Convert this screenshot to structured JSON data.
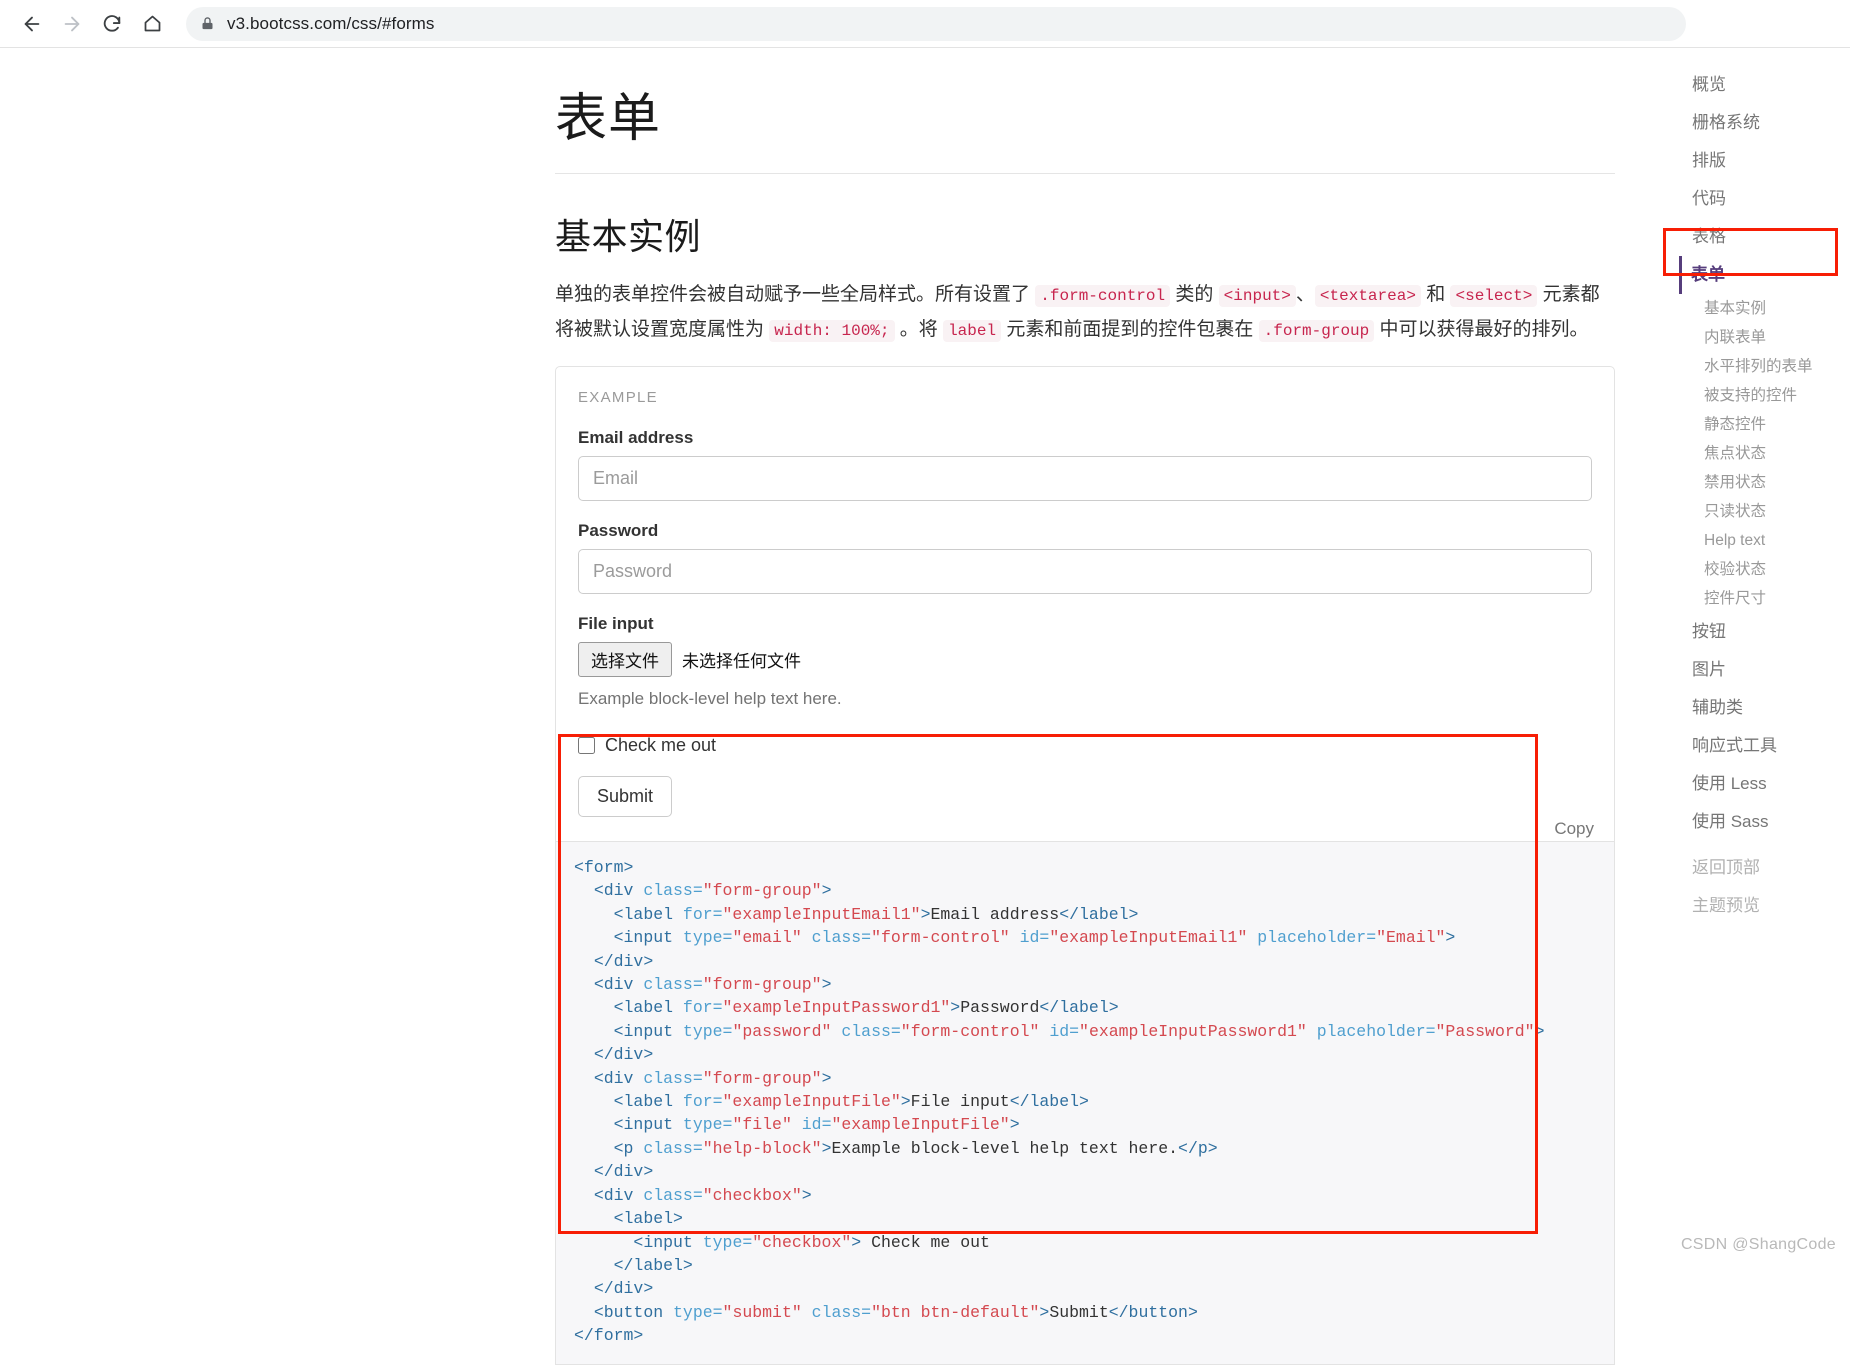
{
  "browser": {
    "back_icon": "arrow-left-icon",
    "forward_icon": "arrow-right-icon",
    "reload_icon": "reload-icon",
    "home_icon": "home-icon",
    "lock_icon": "lock-icon",
    "url": "v3.bootcss.com/css/#forms"
  },
  "main": {
    "page_title": "表单",
    "section_title": "基本实例",
    "paragraph": {
      "p1": "单独的表单控件会被自动赋予一些全局样式。所有设置了 ",
      "c1": ".form-control",
      "p2": " 类的 ",
      "c2": "<input>",
      "p3": "、",
      "c3": "<textarea>",
      "p4": " 和 ",
      "c4": "<select>",
      "p5": " 元素都将被默认设置宽度属性为 ",
      "c5": "width: 100%;",
      "p6": " 。将 ",
      "c6": "label",
      "p7": " 元素和前面提到的控件包裹在 ",
      "c7": ".form-group",
      "p8": " 中可以获得最好的排列。"
    }
  },
  "example": {
    "label": "EXAMPLE",
    "email_label": "Email address",
    "email_placeholder": "Email",
    "email_value": "",
    "password_label": "Password",
    "password_placeholder": "Password",
    "password_value": "",
    "file_label": "File input",
    "file_button": "选择文件",
    "file_status": "未选择任何文件",
    "help_text": "Example block-level help text here.",
    "checkbox_label": "Check me out",
    "checkbox_checked": false,
    "submit_label": "Submit"
  },
  "code": {
    "copy_label": "Copy",
    "lines": [
      [
        [
          "t-tag",
          "<form>"
        ]
      ],
      [
        [
          "t-txt",
          "  "
        ],
        [
          "t-tag",
          "<div "
        ],
        [
          "t-attr",
          "class="
        ],
        [
          "t-str",
          "\"form-group\""
        ],
        [
          "t-tag",
          ">"
        ]
      ],
      [
        [
          "t-txt",
          "    "
        ],
        [
          "t-tag",
          "<label "
        ],
        [
          "t-attr",
          "for="
        ],
        [
          "t-str",
          "\"exampleInputEmail1\""
        ],
        [
          "t-tag",
          ">"
        ],
        [
          "t-txt",
          "Email address"
        ],
        [
          "t-tag",
          "</label>"
        ]
      ],
      [
        [
          "t-txt",
          "    "
        ],
        [
          "t-tag",
          "<input "
        ],
        [
          "t-attr",
          "type="
        ],
        [
          "t-str",
          "\"email\""
        ],
        [
          "t-txt",
          " "
        ],
        [
          "t-attr",
          "class="
        ],
        [
          "t-str",
          "\"form-control\""
        ],
        [
          "t-txt",
          " "
        ],
        [
          "t-attr",
          "id="
        ],
        [
          "t-str",
          "\"exampleInputEmail1\""
        ],
        [
          "t-txt",
          " "
        ],
        [
          "t-attr",
          "placeholder="
        ],
        [
          "t-str",
          "\"Email\""
        ],
        [
          "t-tag",
          ">"
        ]
      ],
      [
        [
          "t-txt",
          "  "
        ],
        [
          "t-tag",
          "</div>"
        ]
      ],
      [
        [
          "t-txt",
          "  "
        ],
        [
          "t-tag",
          "<div "
        ],
        [
          "t-attr",
          "class="
        ],
        [
          "t-str",
          "\"form-group\""
        ],
        [
          "t-tag",
          ">"
        ]
      ],
      [
        [
          "t-txt",
          "    "
        ],
        [
          "t-tag",
          "<label "
        ],
        [
          "t-attr",
          "for="
        ],
        [
          "t-str",
          "\"exampleInputPassword1\""
        ],
        [
          "t-tag",
          ">"
        ],
        [
          "t-txt",
          "Password"
        ],
        [
          "t-tag",
          "</label>"
        ]
      ],
      [
        [
          "t-txt",
          "    "
        ],
        [
          "t-tag",
          "<input "
        ],
        [
          "t-attr",
          "type="
        ],
        [
          "t-str",
          "\"password\""
        ],
        [
          "t-txt",
          " "
        ],
        [
          "t-attr",
          "class="
        ],
        [
          "t-str",
          "\"form-control\""
        ],
        [
          "t-txt",
          " "
        ],
        [
          "t-attr",
          "id="
        ],
        [
          "t-str",
          "\"exampleInputPassword1\""
        ],
        [
          "t-txt",
          " "
        ],
        [
          "t-attr",
          "placeholder="
        ],
        [
          "t-str",
          "\"Password\""
        ],
        [
          "t-tag",
          ">"
        ]
      ],
      [
        [
          "t-txt",
          "  "
        ],
        [
          "t-tag",
          "</div>"
        ]
      ],
      [
        [
          "t-txt",
          "  "
        ],
        [
          "t-tag",
          "<div "
        ],
        [
          "t-attr",
          "class="
        ],
        [
          "t-str",
          "\"form-group\""
        ],
        [
          "t-tag",
          ">"
        ]
      ],
      [
        [
          "t-txt",
          "    "
        ],
        [
          "t-tag",
          "<label "
        ],
        [
          "t-attr",
          "for="
        ],
        [
          "t-str",
          "\"exampleInputFile\""
        ],
        [
          "t-tag",
          ">"
        ],
        [
          "t-txt",
          "File input"
        ],
        [
          "t-tag",
          "</label>"
        ]
      ],
      [
        [
          "t-txt",
          "    "
        ],
        [
          "t-tag",
          "<input "
        ],
        [
          "t-attr",
          "type="
        ],
        [
          "t-str",
          "\"file\""
        ],
        [
          "t-txt",
          " "
        ],
        [
          "t-attr",
          "id="
        ],
        [
          "t-str",
          "\"exampleInputFile\""
        ],
        [
          "t-tag",
          ">"
        ]
      ],
      [
        [
          "t-txt",
          "    "
        ],
        [
          "t-tag",
          "<p "
        ],
        [
          "t-attr",
          "class="
        ],
        [
          "t-str",
          "\"help-block\""
        ],
        [
          "t-tag",
          ">"
        ],
        [
          "t-txt",
          "Example block-level help text here."
        ],
        [
          "t-tag",
          "</p>"
        ]
      ],
      [
        [
          "t-txt",
          "  "
        ],
        [
          "t-tag",
          "</div>"
        ]
      ],
      [
        [
          "t-txt",
          "  "
        ],
        [
          "t-tag",
          "<div "
        ],
        [
          "t-attr",
          "class="
        ],
        [
          "t-str",
          "\"checkbox\""
        ],
        [
          "t-tag",
          ">"
        ]
      ],
      [
        [
          "t-txt",
          "    "
        ],
        [
          "t-tag",
          "<label>"
        ]
      ],
      [
        [
          "t-txt",
          "      "
        ],
        [
          "t-tag",
          "<input "
        ],
        [
          "t-attr",
          "type="
        ],
        [
          "t-str",
          "\"checkbox\""
        ],
        [
          "t-tag",
          ">"
        ],
        [
          "t-txt",
          " Check me out"
        ]
      ],
      [
        [
          "t-txt",
          "    "
        ],
        [
          "t-tag",
          "</label>"
        ]
      ],
      [
        [
          "t-txt",
          "  "
        ],
        [
          "t-tag",
          "</div>"
        ]
      ],
      [
        [
          "t-txt",
          "  "
        ],
        [
          "t-tag",
          "<button "
        ],
        [
          "t-attr",
          "type="
        ],
        [
          "t-str",
          "\"submit\""
        ],
        [
          "t-txt",
          " "
        ],
        [
          "t-attr",
          "class="
        ],
        [
          "t-str",
          "\"btn btn-default\""
        ],
        [
          "t-tag",
          ">"
        ],
        [
          "t-txt",
          "Submit"
        ],
        [
          "t-tag",
          "</button>"
        ]
      ],
      [
        [
          "t-tag",
          "</form>"
        ]
      ]
    ]
  },
  "sidebar": {
    "items": [
      {
        "label": "概览",
        "level": 1,
        "active": false
      },
      {
        "label": "栅格系统",
        "level": 1,
        "active": false
      },
      {
        "label": "排版",
        "level": 1,
        "active": false
      },
      {
        "label": "代码",
        "level": 1,
        "active": false
      },
      {
        "label": "表格",
        "level": 1,
        "active": false
      },
      {
        "label": "表单",
        "level": 1,
        "active": true
      },
      {
        "label": "基本实例",
        "level": 2,
        "active": false
      },
      {
        "label": "内联表单",
        "level": 2,
        "active": false
      },
      {
        "label": "水平排列的表单",
        "level": 2,
        "active": false
      },
      {
        "label": "被支持的控件",
        "level": 2,
        "active": false
      },
      {
        "label": "静态控件",
        "level": 2,
        "active": false
      },
      {
        "label": "焦点状态",
        "level": 2,
        "active": false
      },
      {
        "label": "禁用状态",
        "level": 2,
        "active": false
      },
      {
        "label": "只读状态",
        "level": 2,
        "active": false
      },
      {
        "label": "Help text",
        "level": 2,
        "active": false
      },
      {
        "label": "校验状态",
        "level": 2,
        "active": false
      },
      {
        "label": "控件尺寸",
        "level": 2,
        "active": false
      },
      {
        "label": "按钮",
        "level": 1,
        "active": false
      },
      {
        "label": "图片",
        "level": 1,
        "active": false
      },
      {
        "label": "辅助类",
        "level": 1,
        "active": false
      },
      {
        "label": "响应式工具",
        "level": 1,
        "active": false
      },
      {
        "label": "使用 Less",
        "level": 1,
        "active": false
      },
      {
        "label": "使用 Sass",
        "level": 1,
        "active": false
      }
    ],
    "footer": [
      "返回顶部",
      "主题预览"
    ]
  },
  "annotations": {
    "highlight_color": "#f71e05"
  },
  "watermark": "CSDN @ShangCode"
}
